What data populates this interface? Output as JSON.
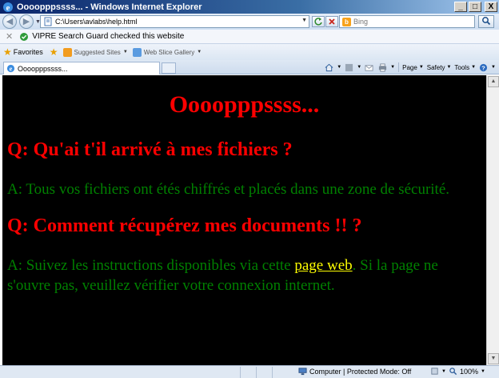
{
  "window": {
    "title": "Oooopppssss... - Windows Internet Explorer",
    "minimize": "_",
    "maximize": "□",
    "close": "X"
  },
  "address_bar": {
    "url": "C:\\Users\\avlabs\\help.html",
    "back_icon": "back-arrow-icon",
    "forward_icon": "forward-arrow-icon",
    "refresh_icon": "refresh-icon",
    "stop_icon": "stop-icon"
  },
  "search": {
    "placeholder": "Bing",
    "button_icon": "search-icon"
  },
  "security_bar": {
    "text": "VIPRE Search Guard checked this website"
  },
  "favorites_bar": {
    "favorites_label": "Favorites",
    "links": [
      {
        "label": "Suggested Sites"
      },
      {
        "label": "Web Slice Gallery"
      }
    ]
  },
  "tabs": [
    {
      "label": "Oooopppssss..."
    }
  ],
  "command_bar": {
    "page_label": "Page",
    "safety_label": "Safety",
    "tools_label": "Tools",
    "help_label": "?"
  },
  "page": {
    "heading": "Oooopppssss...",
    "q1": "Q: Qu'ai t'il arrivé à mes fichiers ?",
    "a1": "A: Tous vos fichiers ont étés chiffrés et placés dans une zone de sécurité.",
    "q2": "Q: Comment récupérez mes documents !! ?",
    "a2_before": "A: Suivez les instructions disponibles via cette ",
    "a2_link": "page web",
    "a2_after": ". Si la page ne s'ouvre pas, veuillez vérifier votre connexion internet."
  },
  "colors": {
    "background": "#000000",
    "heading": "#ff0000",
    "answer": "#008000",
    "link": "#ffff00"
  },
  "status_bar": {
    "zone": "Computer | Protected Mode: Off",
    "zoom": "100%"
  }
}
